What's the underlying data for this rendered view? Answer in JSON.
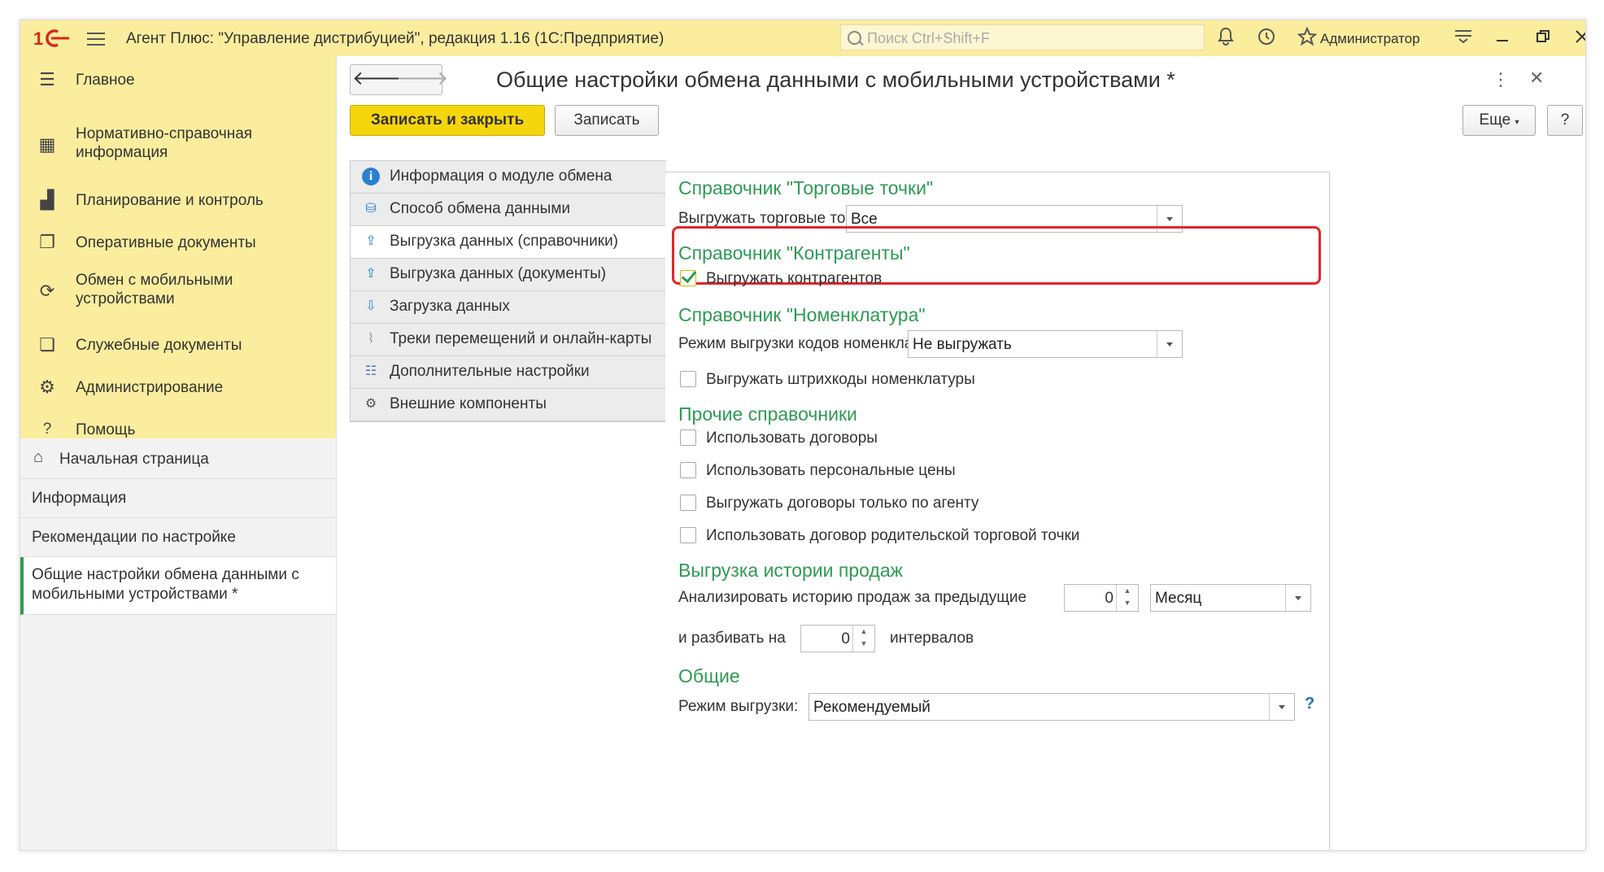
{
  "titlebar": {
    "app_title": "Агент Плюс: \"Управление дистрибуцией\", редакция 1.16  (1С:Предприятие)",
    "search_placeholder": "Поиск Ctrl+Shift+F",
    "user": "Администратор"
  },
  "sidebar": {
    "sections": [
      {
        "label": "Главное",
        "icon": "hamburger-icon"
      },
      {
        "label": "Нормативно-справочная информация",
        "icon": "grid-icon"
      },
      {
        "label": "Планирование и контроль",
        "icon": "bar-chart-icon"
      },
      {
        "label": "Оперативные документы",
        "icon": "documents-icon"
      },
      {
        "label": "Обмен с мобильными устройствами",
        "icon": "refresh-icon"
      },
      {
        "label": "Служебные документы",
        "icon": "service-docs-icon"
      },
      {
        "label": "Администрирование",
        "icon": "gear-icon"
      },
      {
        "label": "Помощь",
        "icon": "question-icon"
      }
    ],
    "nav": [
      {
        "label": "Начальная страница",
        "icon": "home-icon"
      },
      {
        "label": "Информация"
      },
      {
        "label": "Рекомендации по настройке"
      },
      {
        "label": "Общие настройки обмена данными с мобильными устройствами *",
        "active": true
      }
    ]
  },
  "form": {
    "title": "Общие настройки обмена данными с мобильными устройствами *",
    "save_close_label": "Записать и закрыть",
    "save_label": "Записать",
    "more_label": "Еще",
    "help_label": "?"
  },
  "tabs": [
    {
      "label": "Информация о модуле обмена",
      "icon": "info-icon"
    },
    {
      "label": "Способ обмена данными",
      "icon": "exchange-method-icon"
    },
    {
      "label": "Выгрузка данных (справочники)",
      "icon": "upload-icon",
      "active": true
    },
    {
      "label": "Выгрузка данных (документы)",
      "icon": "upload-icon"
    },
    {
      "label": "Загрузка данных",
      "icon": "download-icon"
    },
    {
      "label": "Треки перемещений и онлайн-карты",
      "icon": "map-icon"
    },
    {
      "label": "Дополнительные настройки",
      "icon": "list-icon"
    },
    {
      "label": "Внешние компоненты",
      "icon": "gear-icon"
    }
  ],
  "content": {
    "g1_title": "Справочник \"Торговые точки\"",
    "g1_field_label": "Выгружать торговые точки:",
    "g1_field_value": "Все",
    "g2_title": "Справочник \"Контрагенты\"",
    "g2_check_label": "Выгружать контрагентов",
    "g2_checked": true,
    "g3_title": "Справочник \"Номенклатура\"",
    "g3_field_label": "Режим выгрузки кодов номенклатуры:",
    "g3_field_value": "Не выгружать",
    "g3_check_label": "Выгружать штрихкоды номенклатуры",
    "g4_title": "Прочие справочники",
    "g4_checks": [
      "Использовать договоры",
      "Использовать персональные цены",
      "Выгружать договоры только по агенту",
      "Использовать договор родительской торговой точки"
    ],
    "g5_title": "Выгрузка истории продаж",
    "g5_label1": "Анализировать историю продаж за предыдущие",
    "g5_count": "0",
    "g5_period": "Месяц",
    "g5_label2": "и разбивать на",
    "g5_intervals": "0",
    "g5_label3": "интервалов",
    "g6_title": "Общие",
    "g6_field_label": "Режим выгрузки:",
    "g6_field_value": "Рекомендуемый",
    "g6_help": "?"
  },
  "colors": {
    "accent_yellow": "#fbed9e",
    "primary_button": "#f5d60d",
    "group_title_green": "#2d9b54",
    "highlight_red": "#e3252c"
  }
}
